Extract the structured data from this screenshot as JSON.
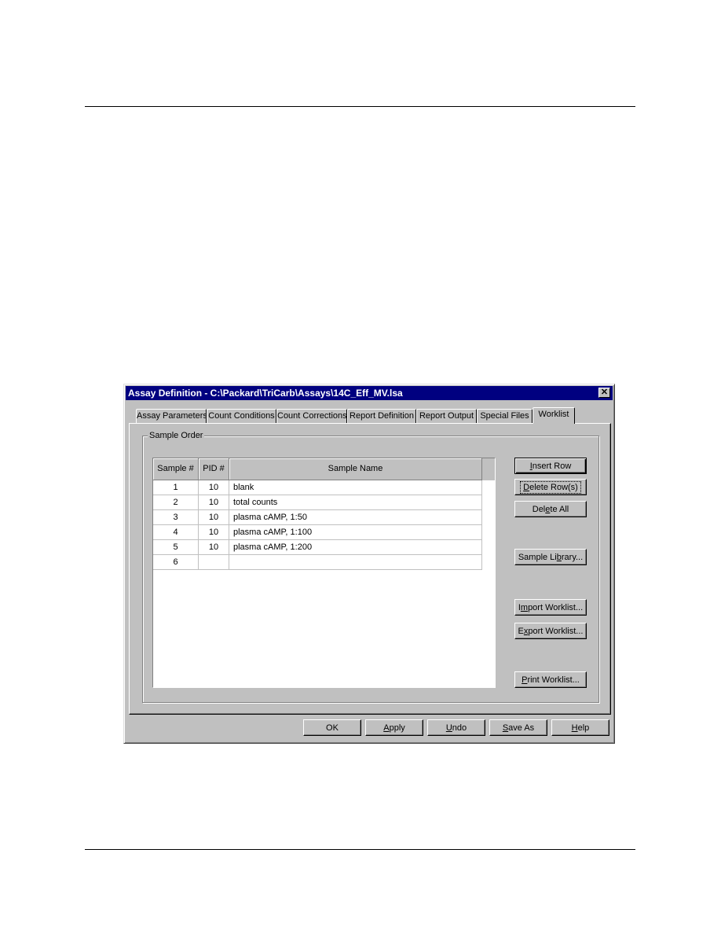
{
  "dialog": {
    "title": "Assay Definition - C:\\Packard\\TriCarb\\Assays\\14C_Eff_MV.lsa",
    "close_glyph": "✕",
    "tabs": [
      {
        "label": "Assay Parameters",
        "active": false
      },
      {
        "label": "Count Conditions",
        "active": false
      },
      {
        "label": "Count Corrections",
        "active": false
      },
      {
        "label": "Report Definition",
        "active": false
      },
      {
        "label": "Report Output",
        "active": false
      },
      {
        "label": "Special Files",
        "active": false
      },
      {
        "label": "Worklist",
        "active": true
      }
    ],
    "group_label": "Sample Order",
    "table": {
      "columns": [
        "Sample #",
        "PID #",
        "Sample Name"
      ],
      "rows": [
        {
          "sample": "1",
          "pid": "10",
          "name": "blank"
        },
        {
          "sample": "2",
          "pid": "10",
          "name": "total counts"
        },
        {
          "sample": "3",
          "pid": "10",
          "name": "plasma cAMP, 1:50"
        },
        {
          "sample": "4",
          "pid": "10",
          "name": "plasma cAMP, 1:100"
        },
        {
          "sample": "5",
          "pid": "10",
          "name": "plasma cAMP, 1:200"
        },
        {
          "sample": "6",
          "pid": "",
          "name": ""
        }
      ]
    },
    "side_buttons": {
      "insert_row": {
        "pre": "",
        "key": "I",
        "post": "nsert Row"
      },
      "delete_rows": {
        "pre": "",
        "key": "D",
        "post": "elete Row(s)"
      },
      "delete_all": {
        "pre": "Del",
        "key": "e",
        "post": "te All"
      },
      "sample_library": {
        "pre": "Sample Li",
        "key": "b",
        "post": "rary..."
      },
      "import_worklist": {
        "pre": "I",
        "key": "m",
        "post": "port Worklist..."
      },
      "export_worklist": {
        "pre": "E",
        "key": "x",
        "post": "port Worklist..."
      },
      "print_worklist": {
        "pre": "",
        "key": "P",
        "post": "rint Worklist..."
      }
    },
    "bottom_buttons": {
      "ok": {
        "pre": "OK",
        "key": "",
        "post": ""
      },
      "apply": {
        "pre": "",
        "key": "A",
        "post": "pply"
      },
      "undo": {
        "pre": "",
        "key": "U",
        "post": "ndo"
      },
      "save_as": {
        "pre": "",
        "key": "S",
        "post": "ave As"
      },
      "help": {
        "pre": "",
        "key": "H",
        "post": "elp"
      }
    }
  }
}
